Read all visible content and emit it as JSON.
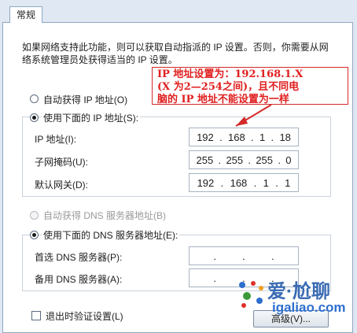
{
  "tab": {
    "label": "常规"
  },
  "description": {
    "line1": "如果网络支持此功能，则可以获取自动指派的 IP 设置。否则，你需要从网",
    "line2": "络系统管理员处获得适当的 IP 设置。"
  },
  "ip_section": {
    "auto_label": "自动获得 IP 地址(O)",
    "manual_label": "使用下面的 IP 地址(S):",
    "selected": "manual",
    "ip_label": "IP 地址(I):",
    "ip": [
      "192",
      "168",
      "1",
      "18"
    ],
    "mask_label": "子网掩码(U):",
    "mask": [
      "255",
      "255",
      "255",
      "0"
    ],
    "gateway_label": "默认网关(D):",
    "gateway": [
      "192",
      "168",
      "1",
      "1"
    ]
  },
  "dns_section": {
    "auto_label": "自动获得 DNS 服务器地址(B)",
    "manual_label": "使用下面的 DNS 服务器地址(E):",
    "selected": "manual",
    "preferred_label": "首选 DNS 服务器(P):",
    "preferred": [
      "",
      "",
      "",
      ""
    ],
    "alternate_label": "备用 DNS 服务器(A):",
    "alternate": [
      "",
      "",
      "",
      ""
    ]
  },
  "footer": {
    "validate_label": "退出时验证设置(L)",
    "validate_checked": false,
    "advanced_label": "高级(V)..."
  },
  "annotation": {
    "line1": "IP 地址设置为：192.168.1.X",
    "line2": "(X 为2—254之间)，且不同电",
    "line3": "脑的 IP 地址不能设置为一样",
    "color": "#e02020"
  },
  "watermark": {
    "brand": "爱·尬聊",
    "url": "igaliao.com"
  }
}
